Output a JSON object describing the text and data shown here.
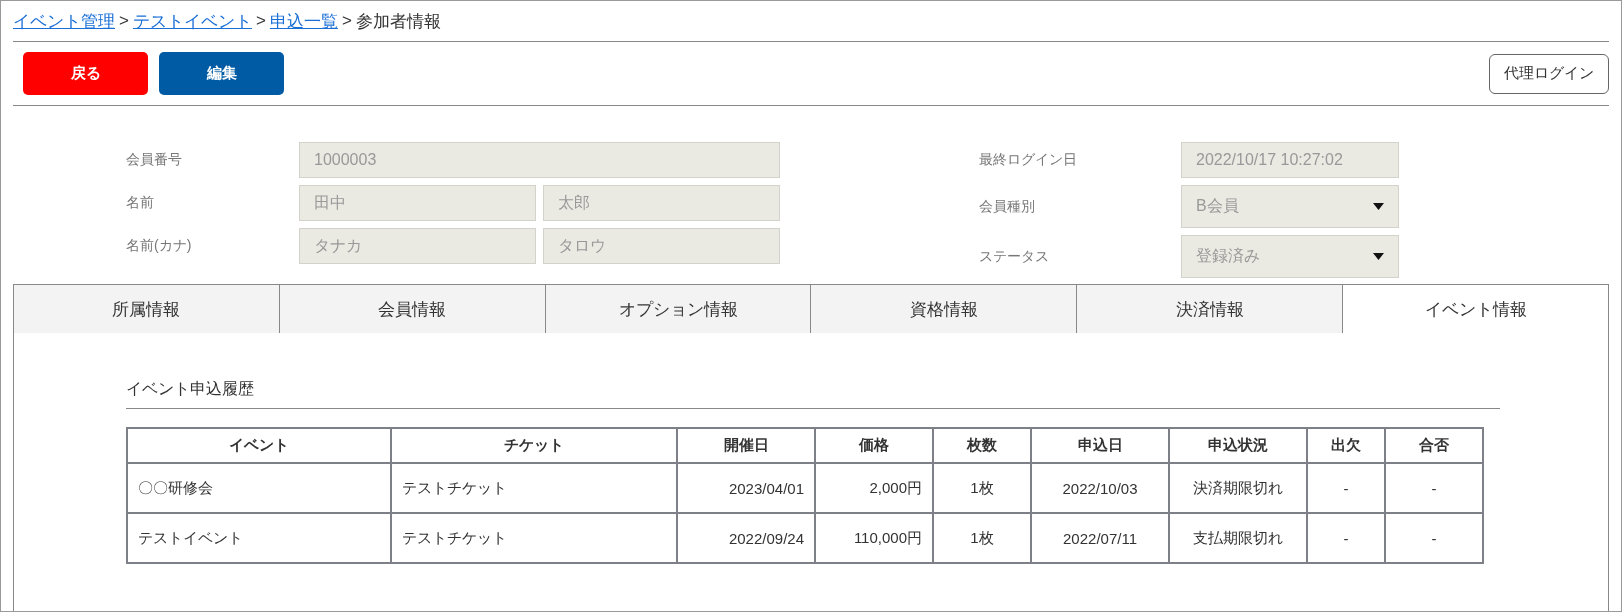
{
  "breadcrumb": {
    "separator": ">",
    "items": [
      {
        "label": "イベント管理",
        "kind": "link"
      },
      {
        "label": "テストイベント",
        "kind": "link"
      },
      {
        "label": "申込一覧",
        "kind": "link"
      },
      {
        "label": "参加者情報",
        "kind": "current"
      }
    ]
  },
  "toolbar": {
    "buttons": [
      {
        "label": "戻る",
        "kind": "danger"
      },
      {
        "label": "編集",
        "kind": "primary"
      }
    ],
    "proxy_login": "代理ログイン"
  },
  "member_form": {
    "left": [
      {
        "label": "会員番号",
        "values": [
          "1000003"
        ]
      },
      {
        "label": "名前",
        "values": [
          "田中",
          "太郎"
        ]
      },
      {
        "label": "名前(カナ)",
        "values": [
          "タナカ",
          "タロウ"
        ]
      }
    ],
    "right": [
      {
        "label": "最終ログイン日",
        "value": "2022/10/17 10:27:02",
        "kind": "text"
      },
      {
        "label": "会員種別",
        "value": "B会員",
        "kind": "select"
      },
      {
        "label": "ステータス",
        "value": "登録済み",
        "kind": "select"
      }
    ]
  },
  "tabs": [
    {
      "label": "所属情報",
      "selected": false
    },
    {
      "label": "会員情報",
      "selected": false
    },
    {
      "label": "オプション情報",
      "selected": false
    },
    {
      "label": "資格情報",
      "selected": false
    },
    {
      "label": "決済情報",
      "selected": false
    },
    {
      "label": "イベント情報",
      "selected": true
    }
  ],
  "event_history": {
    "title": "イベント申込履歴",
    "table": {
      "columns": [
        "イベント",
        "チケット",
        "開催日",
        "価格",
        "枚数",
        "申込日",
        "申込状況",
        "出欠",
        "合否"
      ],
      "rows": [
        [
          "〇〇研修会",
          "テストチケット",
          "2023/04/01",
          "2,000円",
          "1枚",
          "2022/10/03",
          "決済期限切れ",
          "-",
          "-"
        ],
        [
          "テストイベント",
          "テストチケット",
          "2022/09/24",
          "110,000円",
          "1枚",
          "2022/07/11",
          "支払期限切れ",
          "-",
          "-"
        ]
      ]
    }
  }
}
